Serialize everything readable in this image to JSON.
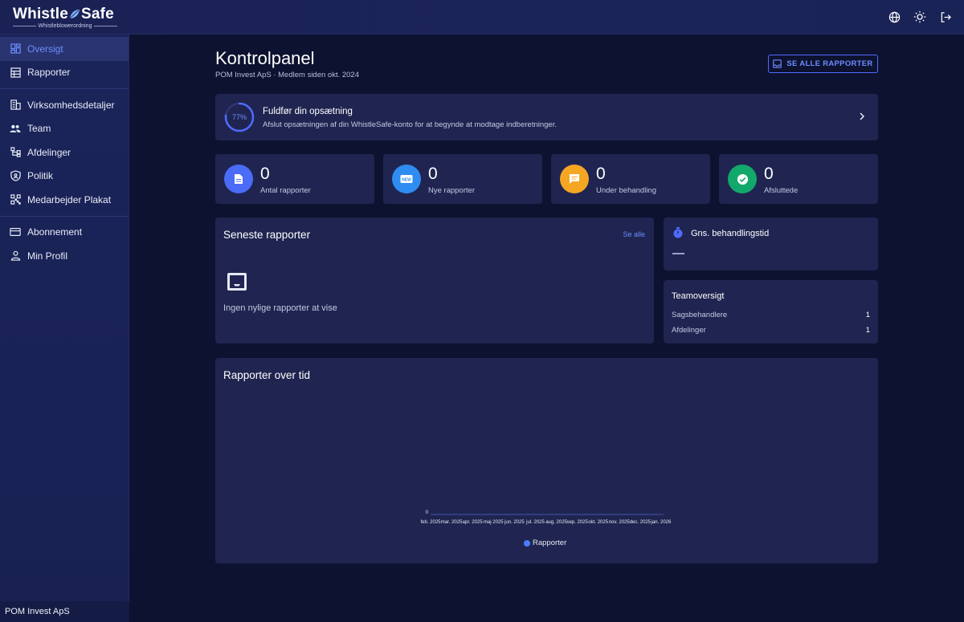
{
  "brand": {
    "name_left": "Whistle",
    "name_right": "Safe",
    "tagline": "Whistleblowerordning"
  },
  "topbar": {
    "icons": [
      "globe-icon",
      "sun-icon",
      "logout-icon"
    ]
  },
  "sidebar": {
    "groups": [
      [
        {
          "label": "Oversigt",
          "icon": "dashboard-icon",
          "active": true
        },
        {
          "label": "Rapporter",
          "icon": "reports-icon",
          "active": false
        }
      ],
      [
        {
          "label": "Virksomhedsdetaljer",
          "icon": "building-icon",
          "active": false
        },
        {
          "label": "Team",
          "icon": "team-icon",
          "active": false
        },
        {
          "label": "Afdelinger",
          "icon": "departments-icon",
          "active": false
        },
        {
          "label": "Politik",
          "icon": "shield-icon",
          "active": false
        },
        {
          "label": "Medarbejder Plakat",
          "icon": "qr-icon",
          "active": false
        }
      ],
      [
        {
          "label": "Abonnement",
          "icon": "card-icon",
          "active": false
        },
        {
          "label": "Min Profil",
          "icon": "user-icon",
          "active": false
        }
      ]
    ],
    "footer": "POM Invest ApS"
  },
  "header": {
    "title": "Kontrolpanel",
    "subtitle": "POM Invest ApS · Medlem siden okt. 2024",
    "see_all_button": "SE ALLE RAPPORTER"
  },
  "setup": {
    "progress_percent": 77,
    "progress_label": "77%",
    "title": "Fuldfør din opsætning",
    "description": "Afslut opsætningen af din WhistleSafe-konto for at begynde at modtage indberetninger."
  },
  "stats": [
    {
      "value": "0",
      "label": "Antal rapporter",
      "color": "#4a6cf7",
      "icon": "document-icon"
    },
    {
      "value": "0",
      "label": "Nye rapporter",
      "color": "#2f8cf0",
      "icon": "new-icon"
    },
    {
      "value": "0",
      "label": "Under behandling",
      "color": "#f5a623",
      "icon": "chat-icon"
    },
    {
      "value": "0",
      "label": "Afsluttede",
      "color": "#13a86b",
      "icon": "check-icon"
    }
  ],
  "recent": {
    "title": "Seneste rapporter",
    "see_all": "Se alle",
    "empty_text": "Ingen nylige rapporter at vise"
  },
  "avg_time": {
    "title": "Gns. behandlingstid",
    "value": "—"
  },
  "team": {
    "title": "Teamoversigt",
    "rows": [
      {
        "label": "Sagsbehandlere",
        "value": "1"
      },
      {
        "label": "Afdelinger",
        "value": "1"
      }
    ]
  },
  "chart_data": {
    "type": "line",
    "title": "Rapporter over tid",
    "categories": [
      "feb. 2025",
      "mar. 2025",
      "apr. 2025",
      "maj 2025",
      "jun. 2025",
      "jul. 2025",
      "aug. 2025",
      "sep. 2025",
      "okt. 2025",
      "nov. 2025",
      "dec. 2025",
      "jan. 2026"
    ],
    "series": [
      {
        "name": "Rapporter",
        "values": [
          0,
          0,
          0,
          0,
          0,
          0,
          0,
          0,
          0,
          0,
          0,
          0
        ],
        "color": "#4b7bff"
      }
    ],
    "y_ticks": [
      "0"
    ],
    "ylim": [
      0,
      0
    ],
    "legend": "bottom"
  }
}
